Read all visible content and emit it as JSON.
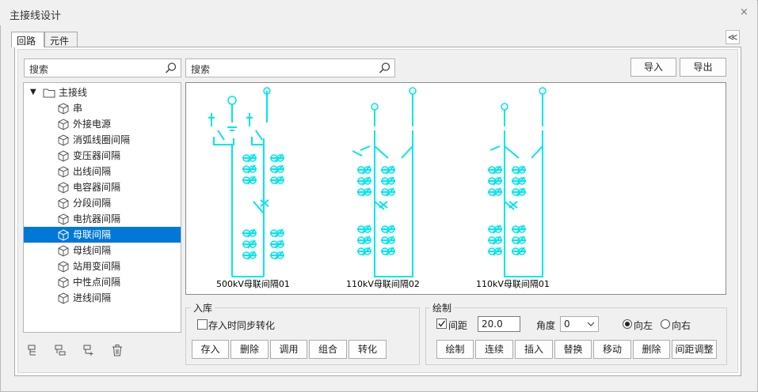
{
  "window": {
    "title": "主接线设计",
    "close": "×"
  },
  "tabs": [
    {
      "label": "回路"
    },
    {
      "label": "元件"
    }
  ],
  "collapse_glyph": "≪",
  "left_search": {
    "placeholder": "搜索"
  },
  "right_search": {
    "placeholder": "搜索"
  },
  "actions": {
    "import": "导入",
    "export": "导出"
  },
  "tree": {
    "root": "主接线",
    "expander": "▼",
    "items": [
      {
        "label": "串"
      },
      {
        "label": "外接电源"
      },
      {
        "label": "消弧线圈间隔"
      },
      {
        "label": "变压器间隔"
      },
      {
        "label": "出线间隔"
      },
      {
        "label": "电容器间隔"
      },
      {
        "label": "分段间隔"
      },
      {
        "label": "电抗器间隔"
      },
      {
        "label": "母联间隔",
        "selected": true
      },
      {
        "label": "母线间隔"
      },
      {
        "label": "站用变间隔"
      },
      {
        "label": "中性点间隔"
      },
      {
        "label": "进线间隔"
      }
    ]
  },
  "diagrams": [
    {
      "label": "500kV母联间隔01"
    },
    {
      "label": "110kV母联间隔02"
    },
    {
      "label": "110kV母联间隔01"
    }
  ],
  "store_group": {
    "title": "入库",
    "sync_checkbox": {
      "label": "存入时同步转化",
      "checked": false
    },
    "buttons": {
      "save": "存入",
      "delete": "删除",
      "call": "调用",
      "combine": "组合",
      "convert": "转化"
    }
  },
  "draw_group": {
    "title": "绘制",
    "spacing": {
      "label": "间距",
      "checked": true,
      "value": "20.0"
    },
    "angle": {
      "label": "角度",
      "value": "0"
    },
    "direction": {
      "left": "向左",
      "right": "向右",
      "selected": "left"
    },
    "buttons": {
      "draw": "绘制",
      "chain": "连续",
      "insert": "插入",
      "replace": "替换",
      "move": "移动",
      "delete": "删除",
      "adjust": "间距调整"
    }
  },
  "colors": {
    "wire": "#00e5ee",
    "selection": "#0078d7"
  }
}
